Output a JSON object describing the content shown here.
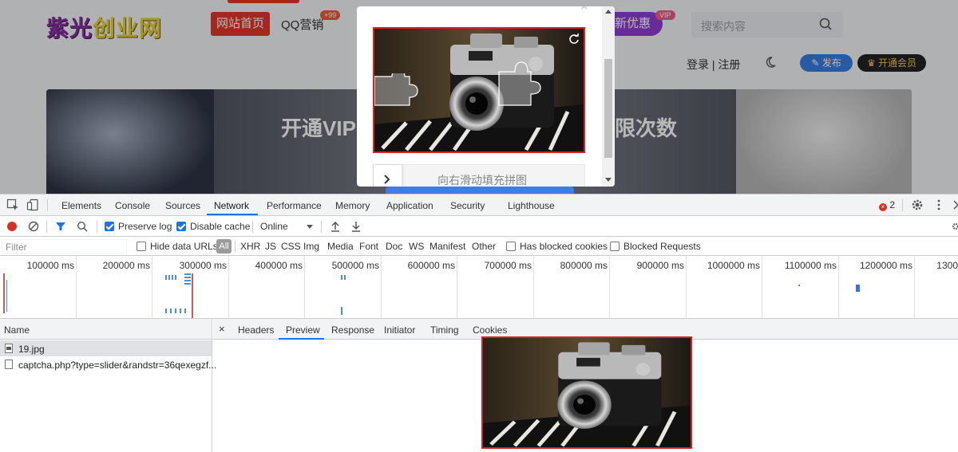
{
  "site": {
    "logo_part1": "紫光",
    "logo_part2": "创业网",
    "nav_home": "网站首页",
    "nav_qq": "QQ营销",
    "nav_qq_badge": "+99",
    "nav_new": "新优惠",
    "nav_new_badge": "VIP",
    "search_placeholder": "搜索内容",
    "login_text": "登录 | 注册",
    "publish_label": "发布",
    "vip_label": "开通会员",
    "banner_left": "开通VIP",
    "banner_right": "限次数"
  },
  "captcha": {
    "close_symbol": "×",
    "slider_hint": "向右滑动填充拼图"
  },
  "devtools": {
    "panel_tabs": [
      "Elements",
      "Console",
      "Sources",
      "Network",
      "Performance",
      "Memory",
      "Application",
      "Security",
      "Lighthouse"
    ],
    "active_tab": "Network",
    "error_count": "2",
    "error_badge": "×",
    "toolbar": {
      "preserve_log": "Preserve log",
      "preserve_log_checked": true,
      "disable_cache": "Disable cache",
      "disable_cache_checked": true,
      "throttling": "Online"
    },
    "filter": {
      "placeholder": "Filter",
      "hide_data_urls": "Hide data URLs",
      "all": "All",
      "types": [
        "XHR",
        "JS",
        "CSS",
        "Img",
        "Media",
        "Font",
        "Doc",
        "WS",
        "Manifest",
        "Other"
      ],
      "has_blocked_cookies": "Has blocked cookies",
      "blocked_requests": "Blocked Requests"
    },
    "overview_ticks": [
      "100000 ms",
      "200000 ms",
      "300000 ms",
      "400000 ms",
      "500000 ms",
      "600000 ms",
      "700000 ms",
      "800000 ms",
      "900000 ms",
      "1000000 ms",
      "1100000 ms",
      "1200000 ms",
      "1300"
    ],
    "name_header": "Name",
    "requests": [
      {
        "name": "19.jpg",
        "selected": true,
        "type": "img"
      },
      {
        "name": "captcha.php?type=slider&randstr=36qexegzf...",
        "selected": false,
        "type": "doc"
      }
    ],
    "detail_close": "×",
    "detail_tabs": [
      "Headers",
      "Preview",
      "Response",
      "Initiator",
      "Timing",
      "Cookies"
    ],
    "detail_active": "Preview"
  },
  "colors": {
    "accent_blue": "#1a73e8",
    "record_red": "#d93025",
    "highlight_red": "#e02020"
  }
}
